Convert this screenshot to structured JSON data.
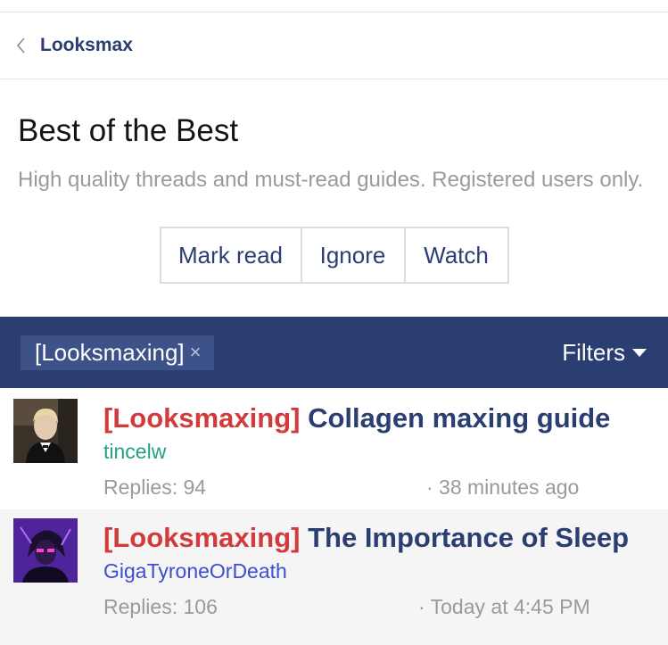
{
  "breadcrumb": {
    "label": "Looksmax",
    "icon": "chevron-left-icon"
  },
  "forum": {
    "title": "Best of the Best",
    "description": "High quality threads and must-read guides. Registered users only.",
    "buttons": {
      "mark_read": "Mark read",
      "ignore": "Ignore",
      "watch": "Watch"
    }
  },
  "filter_bar": {
    "active_filter": "[Looksmaxing]",
    "remove_symbol": "×",
    "filters_label": "Filters",
    "background": "#2b3e72"
  },
  "threads": [
    {
      "prefix": "[Looksmaxing]",
      "title": "Collagen maxing guide",
      "author": "tincelw",
      "replies": "Replies: 94",
      "time": "· 38 minutes ago"
    },
    {
      "prefix": "[Looksmaxing]",
      "title": "The Importance of Sleep",
      "author": "GigaTyroneOrDeath",
      "replies": "Replies: 106",
      "time": "· Today at 4:45 PM"
    }
  ],
  "colors": {
    "accent": "#2b3e72",
    "prefix": "#d23b3b",
    "muted": "#9a9a9a"
  }
}
